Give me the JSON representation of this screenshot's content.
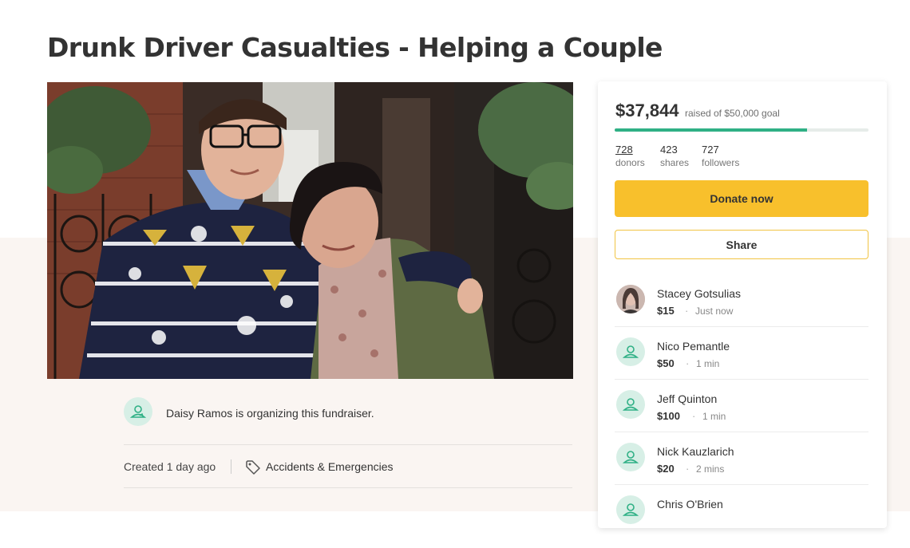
{
  "page": {
    "title": "Drunk Driver Casualties - Helping a Couple"
  },
  "organizer": {
    "text": "Daisy Ramos is organizing this fundraiser.",
    "icon": "user-icon"
  },
  "meta": {
    "created": "Created 1 day ago",
    "category": "Accidents & Emergencies",
    "icon": "tag-icon"
  },
  "progress": {
    "amount": "$37,844",
    "goal_text": "raised of $50,000 goal",
    "fraction": 0.757
  },
  "stats": {
    "donors": {
      "value": "728",
      "label": "donors"
    },
    "shares": {
      "value": "423",
      "label": "shares"
    },
    "followers": {
      "value": "727",
      "label": "followers"
    }
  },
  "buttons": {
    "donate": "Donate now",
    "share": "Share"
  },
  "donations": [
    {
      "name": "Stacey Gotsulias",
      "amount": "$15",
      "time": "Just now",
      "avatar": "photo"
    },
    {
      "name": "Nico Pemantle",
      "amount": "$50",
      "time": "1 min",
      "avatar": "user-icon"
    },
    {
      "name": "Jeff Quinton",
      "amount": "$100",
      "time": "1 min",
      "avatar": "user-icon"
    },
    {
      "name": "Nick Kauzlarich",
      "amount": "$20",
      "time": "2 mins",
      "avatar": "user-icon"
    },
    {
      "name": "Chris O'Brien",
      "amount": "",
      "time": "",
      "avatar": "user-icon"
    }
  ],
  "colors": {
    "accent_green": "#2fb085",
    "donate_yellow": "#f8c02c",
    "icon_bg": "#d7efe6"
  }
}
